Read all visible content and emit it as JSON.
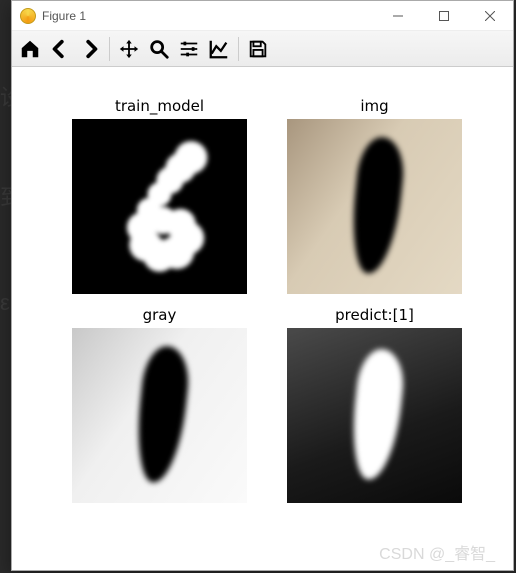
{
  "window": {
    "title": "Figure 1"
  },
  "toolbar": {
    "home": "home-icon",
    "back": "arrow-left-icon",
    "forward": "arrow-right-icon",
    "pan": "move-icon",
    "zoom": "magnify-icon",
    "configure": "sliders-icon",
    "axes": "chart-line-icon",
    "save": "floppy-icon"
  },
  "chart_data": [
    {
      "title": "train_model",
      "type": "image",
      "description": "MNIST digit 6, white on black, 28x28 pixelated"
    },
    {
      "title": "img",
      "type": "image",
      "description": "Color photo of handwritten digit 1, dark stroke on beige paper"
    },
    {
      "title": "gray",
      "type": "image",
      "description": "Grayscale version of digit 1, dark stroke on light background"
    },
    {
      "title": "predict:[1]",
      "type": "image",
      "description": "Inverted binary image of digit 1, white stroke on black"
    }
  ],
  "watermark": "CSDN @_睿智_"
}
